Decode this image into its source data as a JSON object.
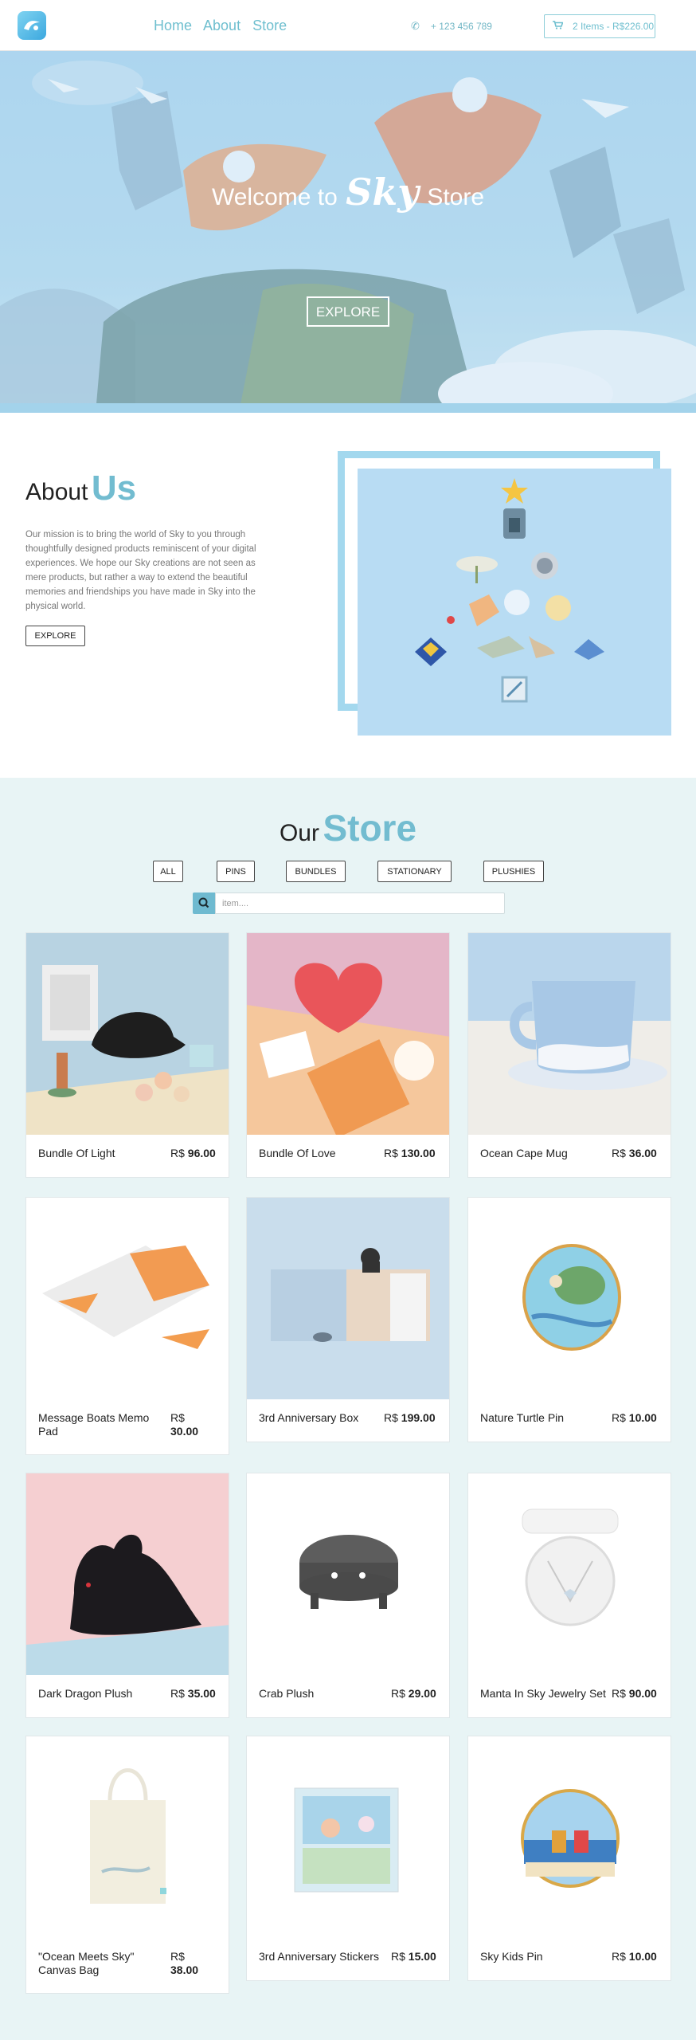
{
  "nav": {
    "links": [
      "Home",
      "About",
      "Store"
    ],
    "phone": "+ 123 456 789",
    "cart": "2 Items - R$226.00"
  },
  "hero": {
    "welcome": "Welcome to",
    "script": "Sky",
    "store": "Store",
    "cta": "EXPLORE"
  },
  "about": {
    "title_a": "About",
    "title_b": "Us",
    "text": "Our mission is to bring the world of Sky to you through thoughtfully designed products reminiscent of your digital experiences. We hope our Sky creations are not seen as mere products, but rather a way to extend the beautiful memories and friendships you have made in Sky into the physical world.",
    "cta": "EXPLORE"
  },
  "store": {
    "title_a": "Our",
    "title_b": "Store",
    "filters": [
      "ALL",
      "PINS",
      "BUNDLES",
      "STATIONARY",
      "PLUSHIES"
    ],
    "search_placeholder": "item....",
    "currency": "R$",
    "products": [
      {
        "name": "Bundle Of Light",
        "price": "96.00"
      },
      {
        "name": "Bundle Of Love",
        "price": "130.00"
      },
      {
        "name": "Ocean Cape Mug",
        "price": "36.00"
      },
      {
        "name": "Message Boats Memo Pad",
        "price": "30.00"
      },
      {
        "name": "3rd Anniversary Box",
        "price": "199.00"
      },
      {
        "name": "Nature Turtle Pin",
        "price": "10.00"
      },
      {
        "name": "Dark Dragon Plush",
        "price": "35.00"
      },
      {
        "name": "Crab Plush",
        "price": "29.00"
      },
      {
        "name": "Manta In Sky Jewelry Set",
        "price": "90.00"
      },
      {
        "name": "\"Ocean Meets Sky\" Canvas Bag",
        "price": "38.00"
      },
      {
        "name": "3rd Anniversary Stickers",
        "price": "15.00"
      },
      {
        "name": "Sky Kids Pin",
        "price": "10.00"
      }
    ]
  },
  "colors": {
    "accent": "#72bcd0",
    "store_bg": "#e8f4f5",
    "hero_bg": "#9bcdeb"
  }
}
